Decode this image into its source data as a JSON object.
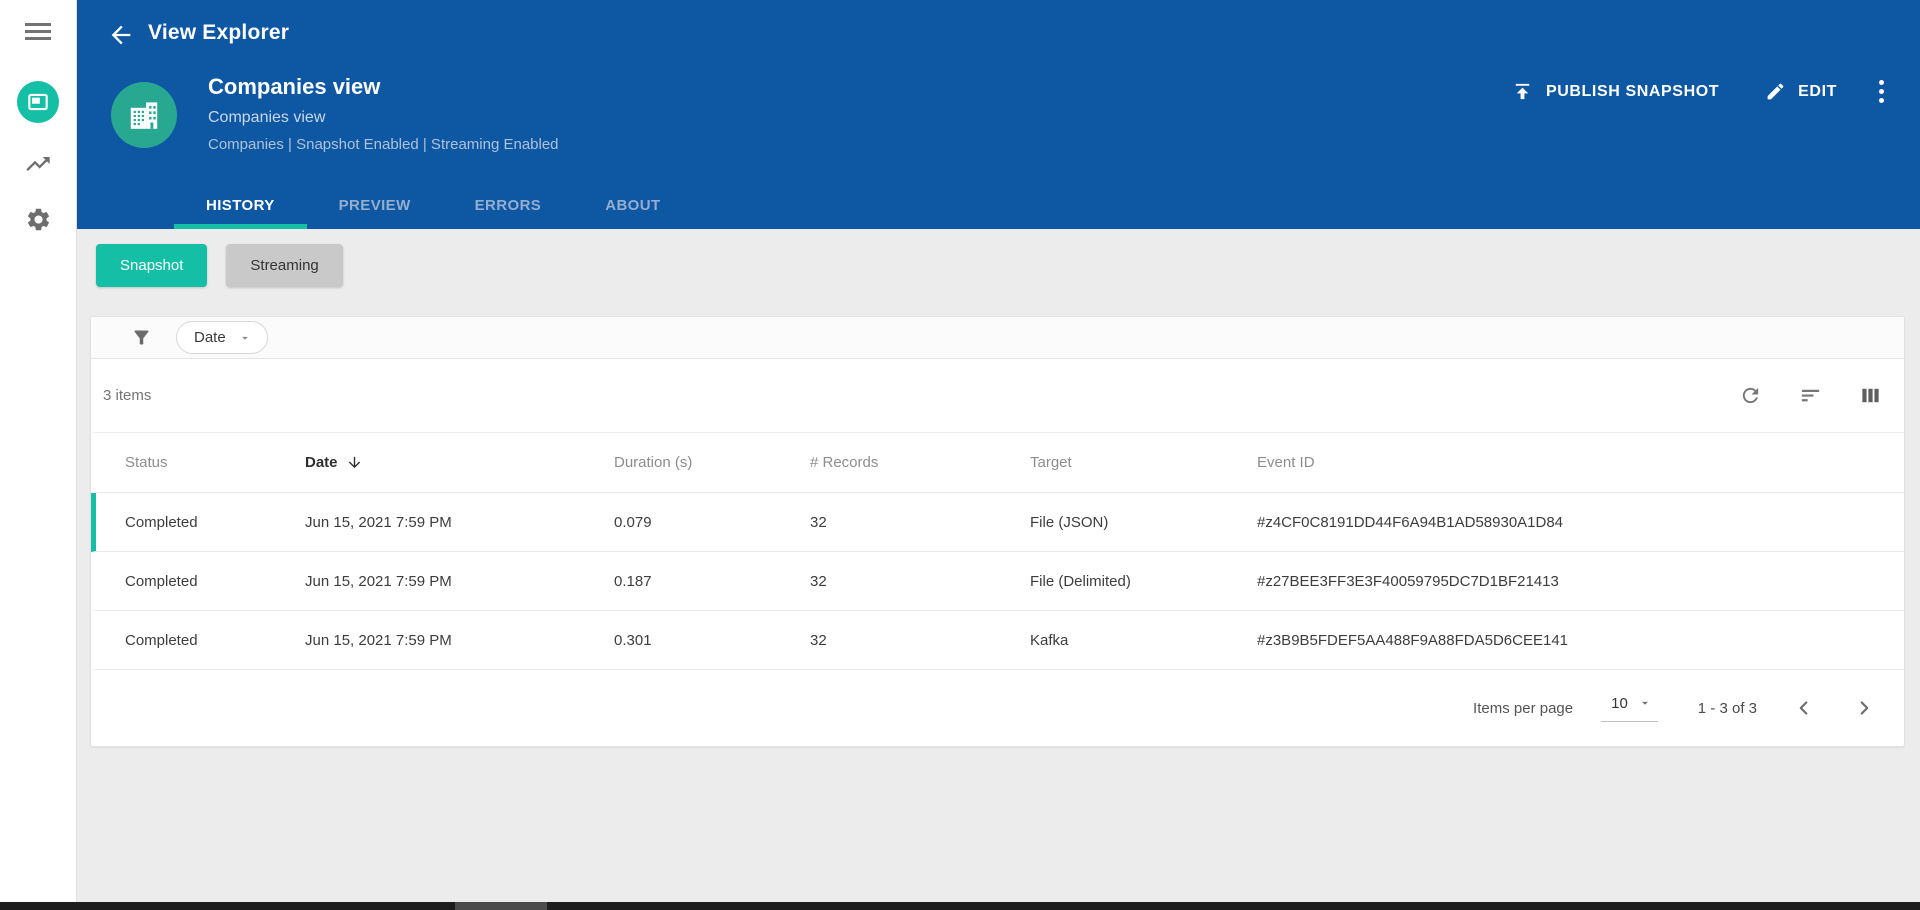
{
  "colors": {
    "blue": "#0d57a3",
    "teal": "#14bfa6",
    "avatar_teal": "#28a791",
    "content_bg": "#ececec"
  },
  "icons": {
    "sidebar": [
      "menu-icon",
      "views-icon",
      "trending-up-icon",
      "settings-gear-icon"
    ],
    "header": [
      "back-arrow-icon",
      "building-icon",
      "upload-icon",
      "edit-pencil-icon",
      "kebab-menu-icon"
    ],
    "toolbar": [
      "filter-funnel-icon",
      "chevron-down-icon",
      "refresh-icon",
      "sort-lines-icon",
      "columns-icon"
    ],
    "table": [
      "arrow-down-icon"
    ],
    "pagination": [
      "chevron-down-icon",
      "chevron-left-icon",
      "chevron-right-icon"
    ]
  },
  "header": {
    "app_title": "View Explorer",
    "view_title": "Companies view",
    "view_subtitle": "Companies view",
    "view_meta": "Companies | Snapshot Enabled | Streaming Enabled",
    "actions": {
      "publish_label": "PUBLISH SNAPSHOT",
      "edit_label": "EDIT"
    },
    "tabs": [
      {
        "label": "HISTORY",
        "active": true
      },
      {
        "label": "PREVIEW",
        "active": false
      },
      {
        "label": "ERRORS",
        "active": false
      },
      {
        "label": "ABOUT",
        "active": false
      }
    ]
  },
  "toggles": [
    {
      "label": "Snapshot",
      "active": true
    },
    {
      "label": "Streaming",
      "active": false
    }
  ],
  "filter": {
    "chip_label": "Date"
  },
  "table": {
    "summary": "3 items",
    "columns": [
      {
        "label": "Status",
        "sorted": false
      },
      {
        "label": "Date",
        "sorted": true,
        "direction": "desc"
      },
      {
        "label": "Duration (s)",
        "sorted": false
      },
      {
        "label": "# Records",
        "sorted": false
      },
      {
        "label": "Target",
        "sorted": false
      },
      {
        "label": "Event ID",
        "sorted": false
      }
    ],
    "rows": [
      {
        "status": "Completed",
        "date": "Jun 15, 2021 7:59 PM",
        "duration": "0.079",
        "records": "32",
        "target": "File (JSON)",
        "event_id": "#z4CF0C8191DD44F6A94B1AD58930A1D84",
        "highlighted": true
      },
      {
        "status": "Completed",
        "date": "Jun 15, 2021 7:59 PM",
        "duration": "0.187",
        "records": "32",
        "target": "File (Delimited)",
        "event_id": "#z27BEE3FF3E3F40059795DC7D1BF21413",
        "highlighted": false
      },
      {
        "status": "Completed",
        "date": "Jun 15, 2021 7:59 PM",
        "duration": "0.301",
        "records": "32",
        "target": "Kafka",
        "event_id": "#z3B9B5FDEF5AA488F9A88FDA5D6CEE141",
        "highlighted": false
      }
    ]
  },
  "pagination": {
    "items_per_page_label": "Items per page",
    "items_per_page_value": "10",
    "range": "1 - 3 of 3"
  }
}
